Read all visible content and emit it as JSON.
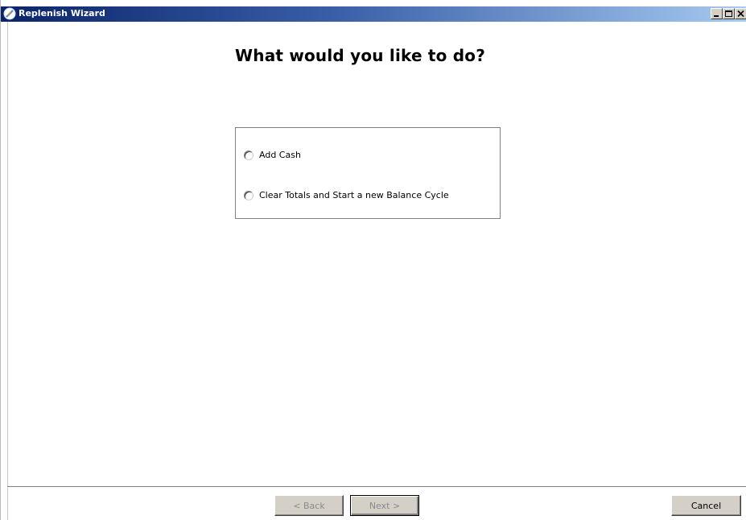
{
  "window": {
    "title": "Replenish Wizard",
    "icon": "wizard-app-icon",
    "controls": [
      "minimize",
      "maximize",
      "close"
    ]
  },
  "main": {
    "heading": "What would you like to do?",
    "options": [
      {
        "label": "Add Cash",
        "selected": false
      },
      {
        "label": "Clear Totals and Start a new Balance Cycle",
        "selected": false
      }
    ]
  },
  "footer": {
    "back_label": "< Back",
    "back_enabled": false,
    "next_label": "Next >",
    "next_enabled": false,
    "cancel_label": "Cancel"
  },
  "colors": {
    "titlebar_start": "#0a246a",
    "titlebar_end": "#a6caf0",
    "button_face": "#d4d0c8"
  }
}
